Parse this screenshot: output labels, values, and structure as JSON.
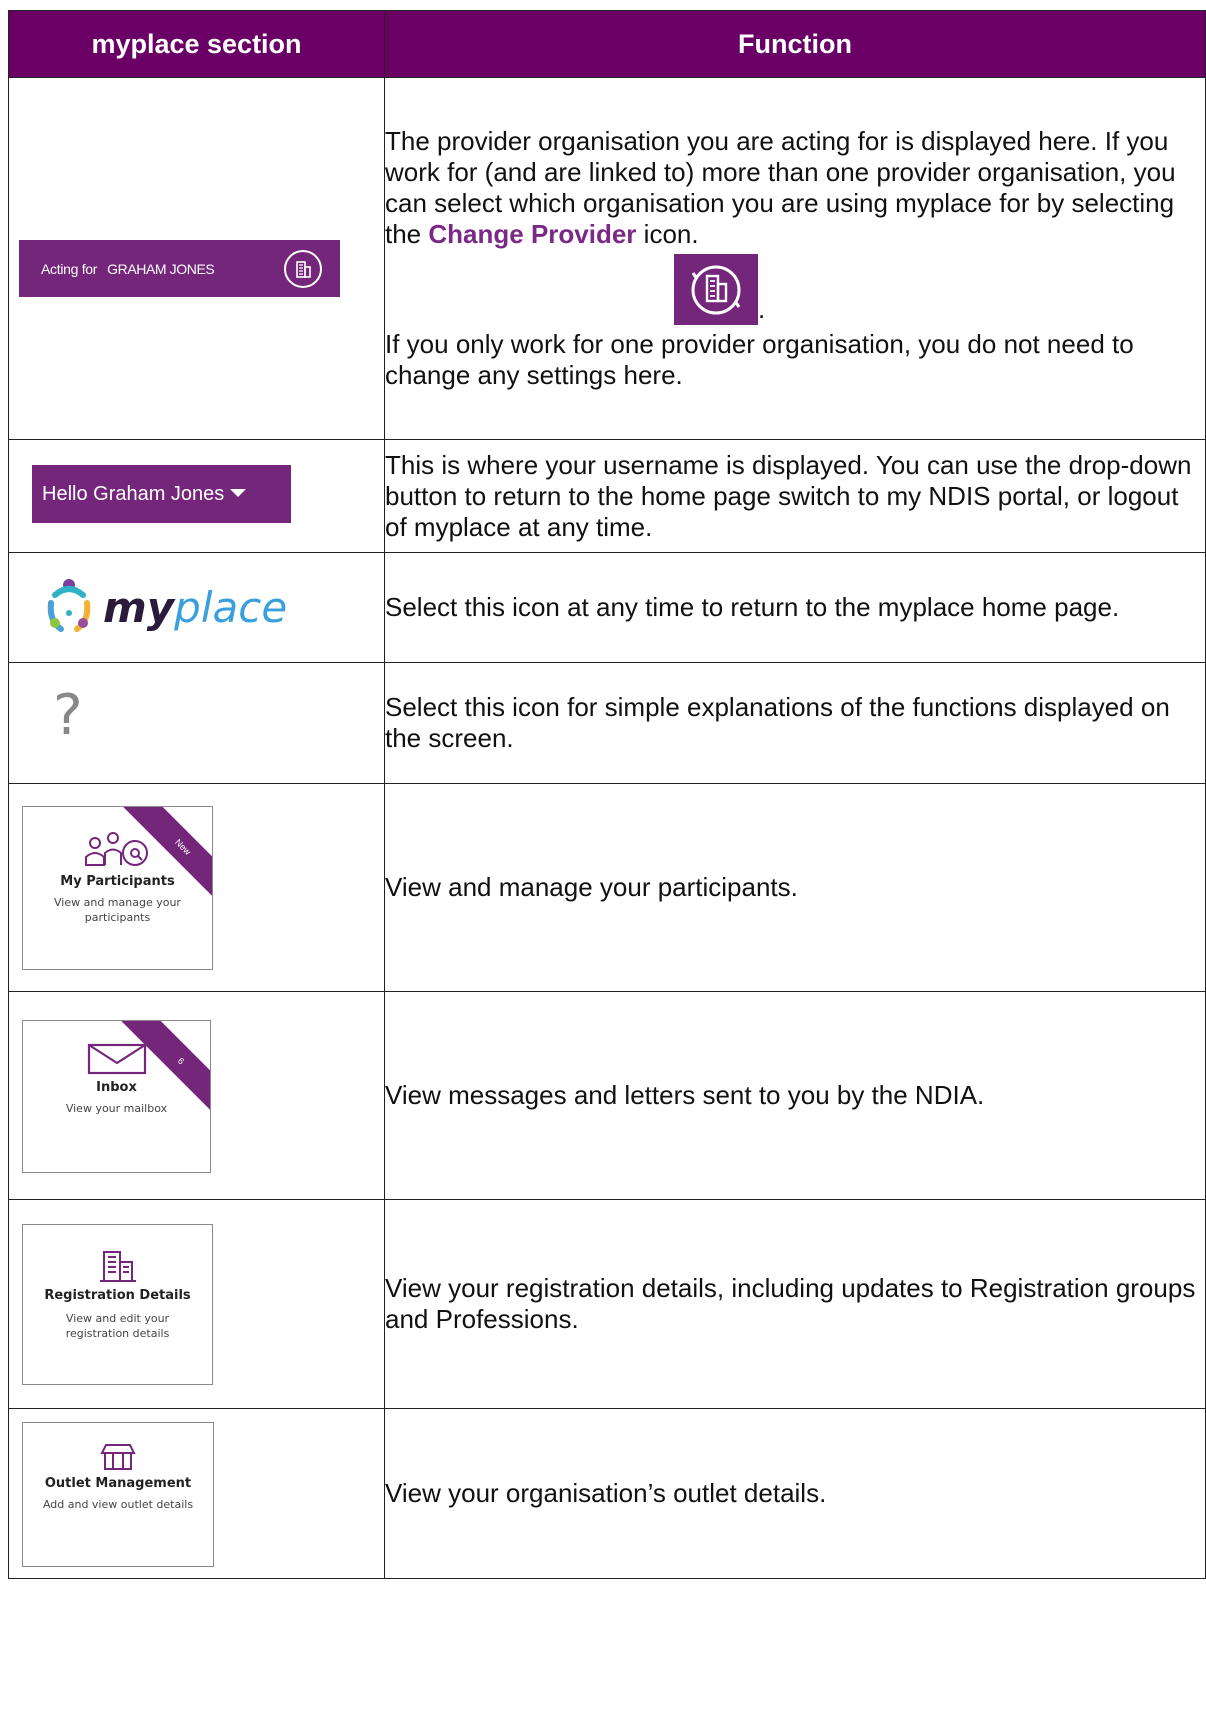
{
  "header": {
    "col1": "myplace section",
    "col2": "Function"
  },
  "row1": {
    "acting_label": "Acting for",
    "acting_name": "GRAHAM JONES",
    "text_a": "The provider organisation you are acting for is displayed here. If you work for (and are linked to) more than one provider organisation, you can select which organisation you are using myplace for by selecting the ",
    "text_link": "Change Provider",
    "text_b": " icon.",
    "period": ".",
    "text_c": "If you only work for one provider organisation, you do not need to change any settings here."
  },
  "row2": {
    "hello_label": "Hello Graham Jones",
    "text": "This is where your username is displayed. You can use the drop-down button to return to the home page switch to my NDIS portal, or logout of myplace at any time."
  },
  "row3": {
    "logo_my": "my",
    "logo_place": "place",
    "text": "Select this icon at any time to return to the myplace home page."
  },
  "row4": {
    "help_glyph": "?",
    "text": "Select this icon for simple explanations of the functions displayed on the screen."
  },
  "row5": {
    "tile_title": "My Participants",
    "tile_sub": "View and manage your participants",
    "ribbon": "New",
    "text": "View and manage your participants."
  },
  "row6": {
    "tile_title": "Inbox",
    "tile_sub": "View your mailbox",
    "ribbon": "6",
    "text": "View messages and letters sent to you by the NDIA."
  },
  "row7": {
    "tile_title": "Registration Details",
    "tile_sub": "View and edit your registration details",
    "text": "View your registration details, including updates to Registration groups and Professions."
  },
  "row8": {
    "tile_title": "Outlet Management",
    "tile_sub": "Add and view outlet details",
    "text": "View your organisation’s outlet details."
  },
  "colors": {
    "header_bg": "#6a0066",
    "brand_purple": "#74277a"
  },
  "icons": [
    "change-provider-icon",
    "dropdown-caret-icon",
    "myplace-logo",
    "help-icon",
    "participants-icon",
    "envelope-icon",
    "building-icon",
    "shop-icon"
  ]
}
